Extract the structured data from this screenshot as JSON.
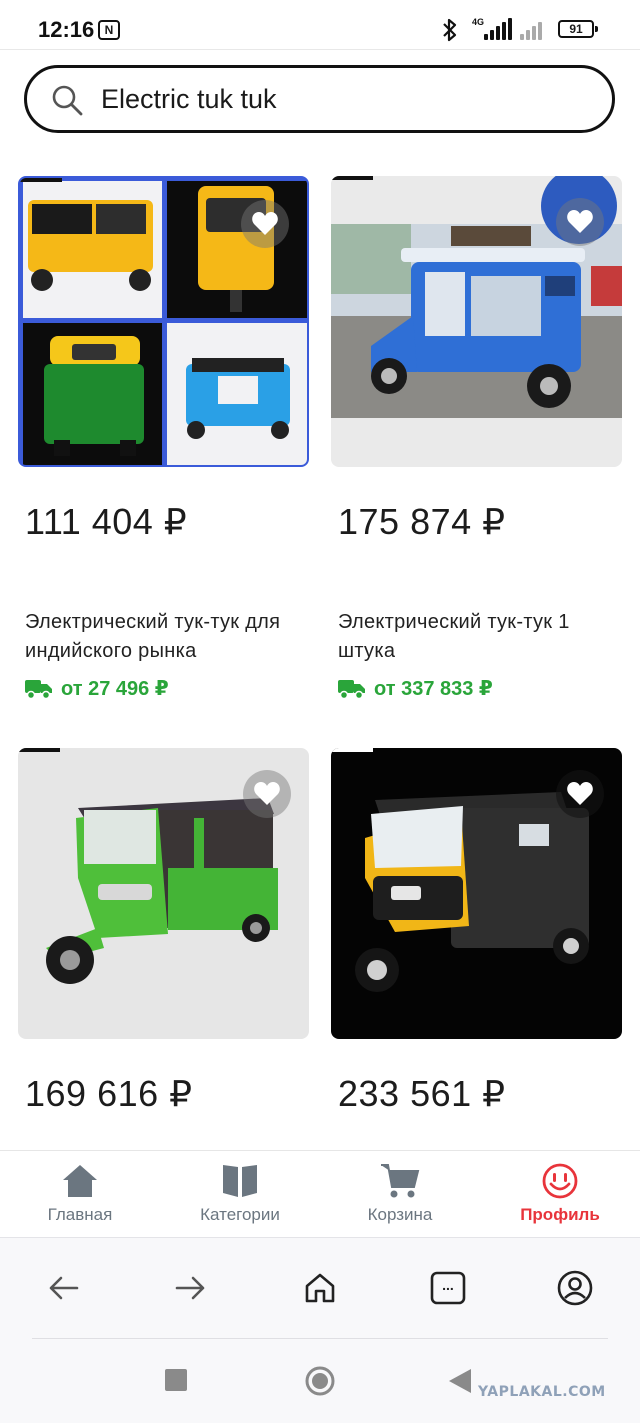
{
  "status_bar": {
    "time": "12:16",
    "network": "4G",
    "battery": "91"
  },
  "search": {
    "value": "Electric tuk tuk"
  },
  "products": [
    {
      "price": "111 404 ₽",
      "title": "Электрический тук-тук для индийского рынка",
      "delivery": "от 27 496 ₽",
      "image": "collage-yellow-green-blue-tuk-tuks"
    },
    {
      "price": "175 874 ₽",
      "title": "Электрический тук-тук 1 штука",
      "delivery": "от 337 833 ₽",
      "image": "blue-tuk-tuk-with-roof-rack"
    },
    {
      "price": "169 616 ₽",
      "image": "green-tuk-tuk"
    },
    {
      "price": "233 561 ₽",
      "image": "black-yellow-tuk-tuk"
    }
  ],
  "bottom_nav": {
    "items": [
      {
        "label": "Главная",
        "icon": "home-icon"
      },
      {
        "label": "Категории",
        "icon": "book-icon"
      },
      {
        "label": "Корзина",
        "icon": "cart-icon"
      },
      {
        "label": "Профиль",
        "icon": "smile-icon",
        "active": true
      }
    ]
  },
  "browser_bar": {
    "buttons": [
      "back-icon",
      "forward-icon",
      "home-icon",
      "tabs-icon",
      "account-icon"
    ],
    "tabs_label": "..."
  },
  "watermark": "YAPLAKAL.COM",
  "colors": {
    "accent_red": "#e8343b",
    "delivery_green": "#2aa53a",
    "text": "#1a1a1a"
  }
}
